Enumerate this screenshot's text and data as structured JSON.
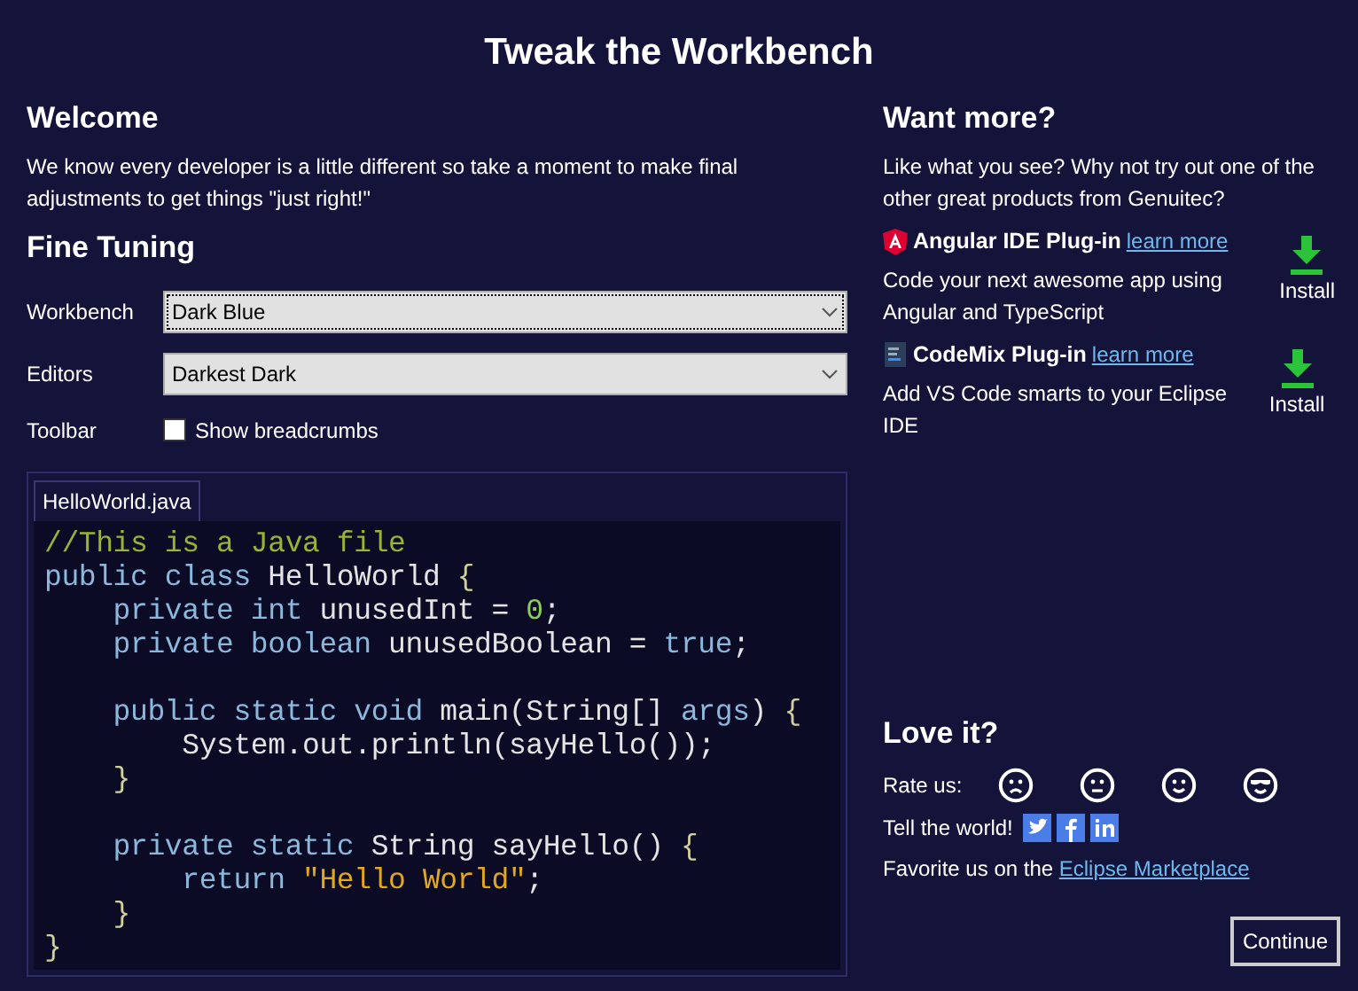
{
  "title": "Tweak the Workbench",
  "welcome": {
    "heading": "Welcome",
    "text": "We know every developer is a little different so take a moment to make final adjustments to get things \"just right!\""
  },
  "fine_tuning": {
    "heading": "Fine Tuning",
    "settings": [
      {
        "kind": "select",
        "label": "Workbench",
        "value": "Dark Blue",
        "focused": true
      },
      {
        "kind": "select",
        "label": "Editors",
        "value": "Darkest Dark",
        "focused": false
      },
      {
        "kind": "checkbox",
        "label": "Toolbar",
        "option": "Show breadcrumbs",
        "checked": false
      }
    ]
  },
  "editor": {
    "tab": "HelloWorld.java",
    "lines": [
      {
        "kind": "code",
        "tokens": [
          {
            "kind": "comment",
            "text": "//This is a Java file"
          }
        ]
      },
      {
        "kind": "code",
        "tokens": [
          {
            "kind": "keyword",
            "text": "public class "
          },
          {
            "kind": "plain",
            "text": "HelloWorld "
          },
          {
            "kind": "brace",
            "text": "{"
          }
        ]
      },
      {
        "kind": "code",
        "tokens": [
          {
            "kind": "keyword",
            "text": "    private int "
          },
          {
            "kind": "plain",
            "text": "unusedInt = "
          },
          {
            "kind": "number",
            "text": "0"
          },
          {
            "kind": "plain",
            "text": ";"
          }
        ]
      },
      {
        "kind": "code",
        "tokens": [
          {
            "kind": "keyword",
            "text": "    private boolean "
          },
          {
            "kind": "plain",
            "text": "unusedBoolean = "
          },
          {
            "kind": "keyword",
            "text": "true"
          },
          {
            "kind": "plain",
            "text": ";"
          }
        ]
      },
      {
        "kind": "blank"
      },
      {
        "kind": "code",
        "tokens": [
          {
            "kind": "keyword",
            "text": "    public static void "
          },
          {
            "kind": "plain",
            "text": "main(String[] "
          },
          {
            "kind": "keyword",
            "text": "args"
          },
          {
            "kind": "plain",
            "text": ") "
          },
          {
            "kind": "brace",
            "text": "{"
          }
        ]
      },
      {
        "kind": "code",
        "tokens": [
          {
            "kind": "plain",
            "text": "        System.out.println(sayHello());"
          }
        ]
      },
      {
        "kind": "code",
        "tokens": [
          {
            "kind": "brace",
            "text": "    }"
          }
        ]
      },
      {
        "kind": "blank"
      },
      {
        "kind": "code",
        "tokens": [
          {
            "kind": "keyword",
            "text": "    private static "
          },
          {
            "kind": "plain",
            "text": "String sayHello() "
          },
          {
            "kind": "brace",
            "text": "{"
          }
        ]
      },
      {
        "kind": "code",
        "tokens": [
          {
            "kind": "keyword",
            "text": "        return "
          },
          {
            "kind": "string",
            "text": "\"Hello World\""
          },
          {
            "kind": "plain",
            "text": ";"
          }
        ]
      },
      {
        "kind": "code",
        "tokens": [
          {
            "kind": "brace",
            "text": "    }"
          }
        ]
      },
      {
        "kind": "code",
        "tokens": [
          {
            "kind": "brace",
            "text": "}"
          }
        ]
      }
    ]
  },
  "want_more": {
    "heading": "Want more?",
    "text": "Like what you see?  Why not try out one of the other great products from Genuitec?",
    "plugins": [
      {
        "kind": "angular",
        "name": "Angular IDE Plug-in",
        "link": "learn more",
        "description": "Code your next awesome app using Angular and TypeScript",
        "install": "Install"
      },
      {
        "kind": "codemix",
        "name": "CodeMix Plug-in",
        "link": "learn more",
        "description": "Add VS Code smarts to your Eclipse IDE",
        "install": "Install"
      }
    ]
  },
  "love_it": {
    "heading": "Love it?",
    "rate_label": "Rate us:",
    "faces": [
      {
        "kind": "sad"
      },
      {
        "kind": "neutral"
      },
      {
        "kind": "smile"
      },
      {
        "kind": "cool"
      }
    ],
    "tell_label": "Tell the world!",
    "social": [
      {
        "kind": "twitter"
      },
      {
        "kind": "facebook"
      },
      {
        "kind": "linkedin"
      }
    ],
    "favorite_text": "Favorite us on the ",
    "favorite_link": "Eclipse Marketplace"
  },
  "continue_button": "Continue"
}
